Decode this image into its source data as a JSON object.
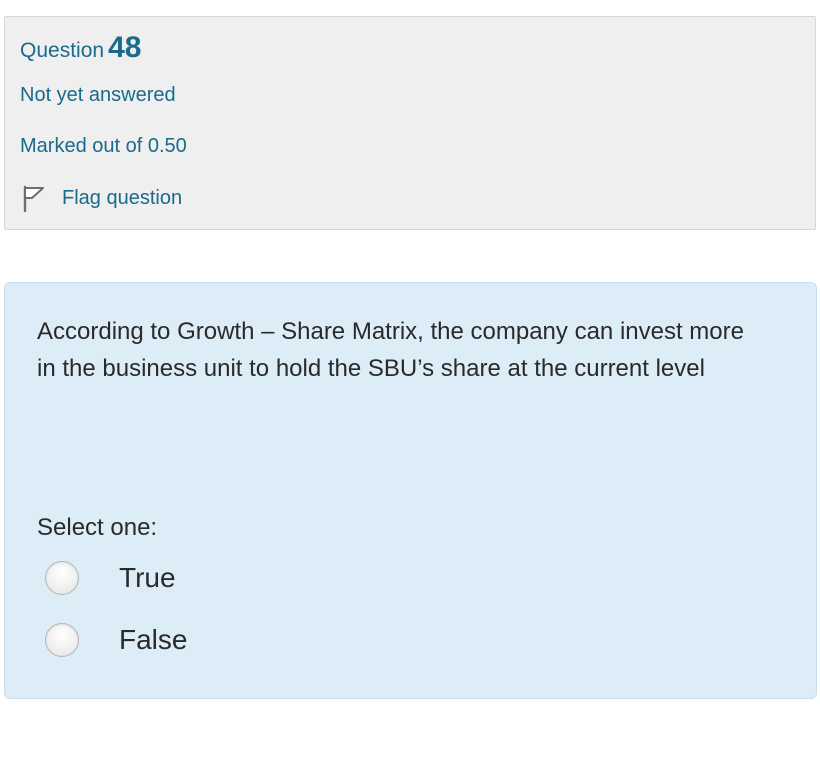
{
  "question_info": {
    "label": "Question",
    "number": "48",
    "state": "Not yet answered",
    "grade": "Marked out of 0.50",
    "flag_label": "Flag question",
    "flag_icon": "flag-icon"
  },
  "question": {
    "text": "According to Growth – Share Matrix, the company can invest more in the business unit to hold the SBU’s share at the current level",
    "prompt": "Select one:",
    "options": [
      {
        "label": "True",
        "selected": false
      },
      {
        "label": "False",
        "selected": false
      }
    ]
  },
  "colors": {
    "info_background": "#efefef",
    "link_blue": "#1b6a8c",
    "content_background": "#dcedf7",
    "text": "#2a2a2a"
  }
}
